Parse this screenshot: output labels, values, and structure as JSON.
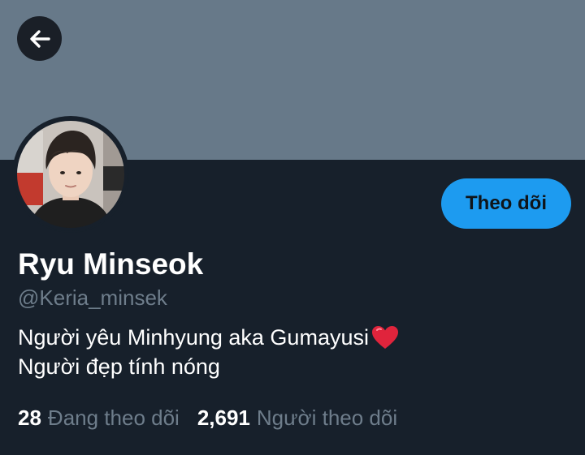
{
  "header": {
    "back_icon": "arrow-left-icon",
    "banner_color": "#677989"
  },
  "profile": {
    "display_name": "Ryu Minseok",
    "handle": "@Keria_minsek",
    "bio_line_1": "Người yêu Minhyung aka Gumayusi",
    "bio_emoji": "red-heart-icon",
    "bio_line_2": "Người đẹp tính nóng",
    "avatar_icon": "avatar-photo"
  },
  "actions": {
    "follow_label": "Theo dõi",
    "follow_color": "#1d9bf0"
  },
  "stats": {
    "following_count": "28",
    "following_label": "Đang theo dõi",
    "followers_count": "2,691",
    "followers_label": "Người theo dõi"
  }
}
